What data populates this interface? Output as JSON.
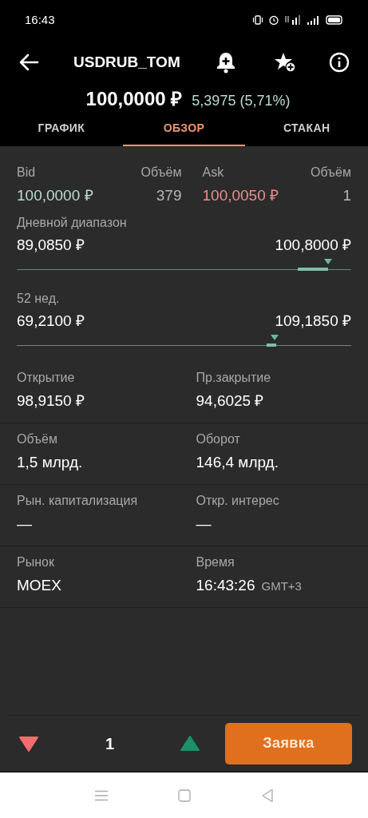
{
  "status_bar": {
    "time": "16:43"
  },
  "header": {
    "title": "USDRUB_TOM",
    "price": "100,0000 ₽",
    "change": "5,3975 (5,71%)"
  },
  "tabs": [
    {
      "label": "ГРАФИК",
      "selected": false
    },
    {
      "label": "ОБЗОР",
      "selected": true
    },
    {
      "label": "СТАКАН",
      "selected": false
    }
  ],
  "quote": {
    "bid_label": "Bid",
    "bid_volume_label": "Объём",
    "ask_label": "Ask",
    "ask_volume_label": "Объём",
    "bid": "100,0000 ₽",
    "bid_volume": "379",
    "ask": "100,0050 ₽",
    "ask_volume": "1"
  },
  "ranges": [
    {
      "label": "Дневной диапазон",
      "low": "89,0850 ₽",
      "high": "100,8000 ₽",
      "level": 0.93
    },
    {
      "label": "52 нед.",
      "low": "69,2100 ₽",
      "high": "109,1850 ₽",
      "level": 0.77
    }
  ],
  "stats": [
    [
      {
        "label": "Открытие",
        "value": "98,9150 ₽"
      },
      {
        "label": "Пр.закрытие",
        "value": "94,6025 ₽"
      }
    ],
    [
      {
        "label": "Объём",
        "value": "1,5 млрд."
      },
      {
        "label": "Оборот",
        "value": "146,4 млрд."
      }
    ],
    [
      {
        "label": "Рын. капитализация",
        "value": "—"
      },
      {
        "label": "Откр. интерес",
        "value": "—"
      }
    ],
    [
      {
        "label": "Рынок",
        "value": "MOEX"
      },
      {
        "label": "Время",
        "value": "16:43:26",
        "suffix": "GMT+3"
      }
    ]
  ],
  "order_bar": {
    "quantity": "1",
    "button": "Заявка"
  }
}
